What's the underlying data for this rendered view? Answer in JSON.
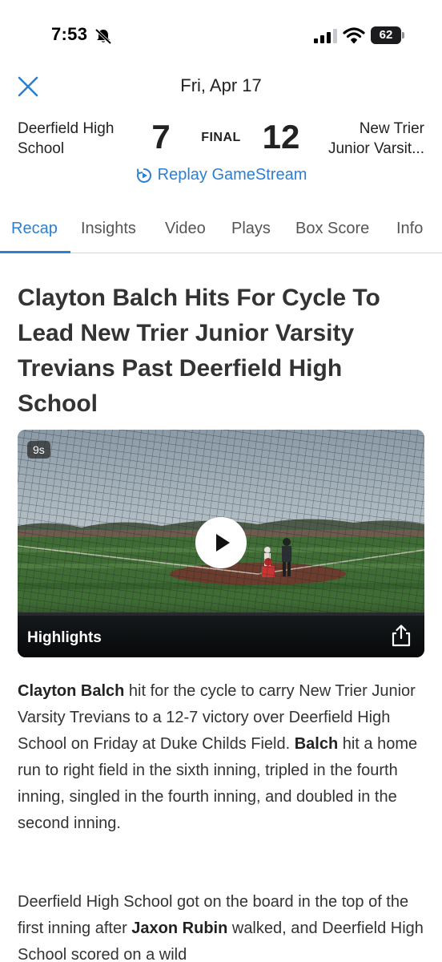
{
  "status_bar": {
    "time": "7:53",
    "battery": "62",
    "icons": [
      "bell-slash-icon",
      "cellular-signal-icon",
      "wifi-icon",
      "battery-icon"
    ]
  },
  "header": {
    "close_icon": "close-icon",
    "date": "Fri, Apr 17"
  },
  "game": {
    "home_team": "Deerfield High School",
    "home_score": "7",
    "status": "FINAL",
    "away_score": "12",
    "away_team_line1": "New Trier",
    "away_team_line2": "Junior Varsit...",
    "replay_label": "Replay GameStream",
    "replay_icon": "replay-icon"
  },
  "tabs": [
    {
      "label": "Recap",
      "active": true
    },
    {
      "label": "Insights",
      "active": false
    },
    {
      "label": "Video",
      "active": false
    },
    {
      "label": "Plays",
      "active": false
    },
    {
      "label": "Box Score",
      "active": false
    },
    {
      "label": "Info",
      "active": false
    }
  ],
  "article": {
    "headline": "Clayton Balch Hits For Cycle To Lead New Trier Junior Varsity Trevians Past Deerfield High School",
    "video": {
      "duration": "9s",
      "label": "Highlights",
      "play_icon": "play-icon",
      "share_icon": "share-icon"
    },
    "p1": {
      "b1": "Clayton Balch",
      "t1": " hit for the cycle to carry New Trier Junior Varsity Trevians to a 12-7 victory over Deerfield High School  on Friday at Duke Childs Field. ",
      "b2": "Balch",
      "t2": " hit a home run to right field in the sixth inning, tripled in the fourth inning, singled in the fourth inning, and doubled in the second inning."
    },
    "p2": {
      "t1": "Deerfield High School  got on the board in the top of the first inning after ",
      "b1": "Jaxon Rubin",
      "t2": " walked, and Deerfield High School  scored on a wild"
    }
  },
  "colors": {
    "accent": "#2c7fd1",
    "text": "#333333"
  }
}
